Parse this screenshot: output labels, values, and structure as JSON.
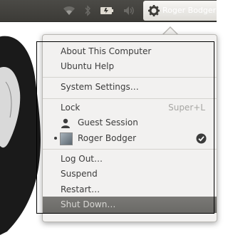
{
  "panel": {
    "user_name": "Roger Bodger",
    "indicators": [
      "wifi-icon",
      "bluetooth-icon",
      "battery-icon",
      "volume-icon"
    ],
    "session_icon": "gear-icon"
  },
  "menu": {
    "about": "About This Computer",
    "help": "Ubuntu Help",
    "system_settings": "System Settings…",
    "lock": "Lock",
    "lock_shortcut": "Super+L",
    "guest_session": "Guest Session",
    "current_user": "Roger Bodger",
    "log_out": "Log Out…",
    "suspend": "Suspend",
    "restart": "Restart…",
    "shut_down": "Shut Down…"
  },
  "colors": {
    "panel": "#3c3b37",
    "menu_bg": "#f2f1f0",
    "highlight": "#6a6966"
  }
}
